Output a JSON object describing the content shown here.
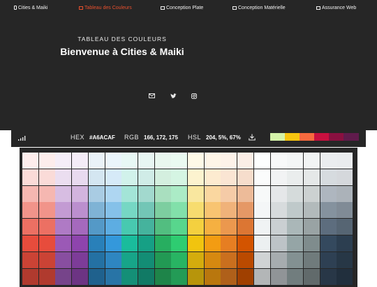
{
  "nav": {
    "items": [
      {
        "label": "Cities & Maiki",
        "icon": "phone-icon",
        "active": false
      },
      {
        "label": "Tableau des Couleurs",
        "icon": "table-icon",
        "active": true
      },
      {
        "label": "Conception Plate",
        "icon": "table-icon",
        "active": false
      },
      {
        "label": "Conception Matérielle",
        "icon": "table-icon",
        "active": false
      },
      {
        "label": "Assurance Web",
        "icon": "table-icon",
        "active": false
      }
    ]
  },
  "hero": {
    "subtitle": "TABLEAU DES COULEURS",
    "title": "Bienvenue à Cities & Maiki",
    "social_icons": [
      "mail-icon",
      "twitter-icon",
      "instagram-icon"
    ]
  },
  "toolbar": {
    "hex_label": "HEX",
    "hex_value": "#A6ACAF",
    "rgb_label": "RGB",
    "rgb_value": "166, 172, 175",
    "hsl_label": "HSL",
    "hsl_value": "204, 5%, 67%",
    "palette": [
      "#d4f2a8",
      "#f7c40f",
      "#f76a3e",
      "#c8103f",
      "#8a1040",
      "#601b4c"
    ]
  },
  "colors": {
    "accent": "#e8502e",
    "background_dark": "#262626",
    "grid_columns": [
      [
        "#fdedec",
        "#fadbd8",
        "#f5b7b1",
        "#f1948a",
        "#ec7063",
        "#e74c3c",
        "#cb4335",
        "#b03a2e"
      ],
      [
        "#fdedec",
        "#fadbd8",
        "#f5b7b1",
        "#f1948a",
        "#ec7063",
        "#e74c3c",
        "#cb4335",
        "#b03a2e"
      ],
      [
        "#f5eef8",
        "#ebdef0",
        "#d7bde2",
        "#c39bd3",
        "#af7ac5",
        "#9b59b6",
        "#884ea0",
        "#76448a"
      ],
      [
        "#f4ecf7",
        "#e8daef",
        "#d2b4de",
        "#bb8fce",
        "#a569bd",
        "#8e44ad",
        "#7d3c98",
        "#6c3483"
      ],
      [
        "#eaf2f8",
        "#d4e6f1",
        "#a9cce3",
        "#7fb3d5",
        "#5499c7",
        "#2980b9",
        "#2471a3",
        "#1f618d"
      ],
      [
        "#ebf5fb",
        "#d6eaf8",
        "#aed6f1",
        "#85c1e9",
        "#5dade2",
        "#3498db",
        "#2e86c1",
        "#2874a6"
      ],
      [
        "#e8f8f5",
        "#d1f2eb",
        "#a3e4d7",
        "#76d7c4",
        "#48c9b0",
        "#1abc9c",
        "#17a589",
        "#148f77"
      ],
      [
        "#e8f6f3",
        "#d0ece7",
        "#a2d9ce",
        "#73c6b6",
        "#45b39d",
        "#16a085",
        "#138d75",
        "#117a65"
      ],
      [
        "#e9f7ef",
        "#d4efdf",
        "#a9dfbf",
        "#7dcea0",
        "#52be80",
        "#27ae60",
        "#229954",
        "#1e8449"
      ],
      [
        "#eafaf1",
        "#d5f5e3",
        "#abebc6",
        "#82e0aa",
        "#58d68d",
        "#2ecc71",
        "#28b463",
        "#239b56"
      ],
      [
        "#fef9e7",
        "#fcf3cf",
        "#f9e79f",
        "#f7dc6f",
        "#f4d03f",
        "#f1c40f",
        "#d4ac0d",
        "#b7950b"
      ],
      [
        "#fef5e7",
        "#fdebd0",
        "#fad7a0",
        "#f8c471",
        "#f5b041",
        "#f39c12",
        "#d68910",
        "#b9770e"
      ],
      [
        "#fdf2e9",
        "#fae5d3",
        "#f5cba7",
        "#f0b27a",
        "#eb984e",
        "#e67e22",
        "#ca6f1e",
        "#af601a"
      ],
      [
        "#fbeee6",
        "#f6ddcc",
        "#edbb99",
        "#e59866",
        "#dc7633",
        "#d35400",
        "#ba4a00",
        "#a04000"
      ],
      [
        "#fdfefe",
        "#fbfcfc",
        "#f7f9f9",
        "#f4f6f7",
        "#f0f3f4",
        "#ecf0f1",
        "#d0d3d4",
        "#b3b6b7"
      ],
      [
        "#f8f9f9",
        "#f2f3f4",
        "#e5e7e9",
        "#d7dbdd",
        "#cacfd2",
        "#bdc3c7",
        "#a6acaf",
        "#909497"
      ],
      [
        "#f4f6f6",
        "#eaeded",
        "#d5dbdb",
        "#bfc9ca",
        "#aab7b8",
        "#95a5a6",
        "#839192",
        "#717d7e"
      ],
      [
        "#f2f4f4",
        "#e5e8e8",
        "#ccd1d1",
        "#b2babb",
        "#99a3a4",
        "#7f8c8d",
        "#707b7c",
        "#616a6b"
      ],
      [
        "#ebedef",
        "#d6dbdf",
        "#aeb6bf",
        "#85929e",
        "#5d6d7e",
        "#34495e",
        "#2e4053",
        "#283747"
      ],
      [
        "#eaecee",
        "#d5d8dc",
        "#abb2b9",
        "#808b96",
        "#566573",
        "#2c3e50",
        "#273746",
        "#212f3d"
      ]
    ]
  }
}
